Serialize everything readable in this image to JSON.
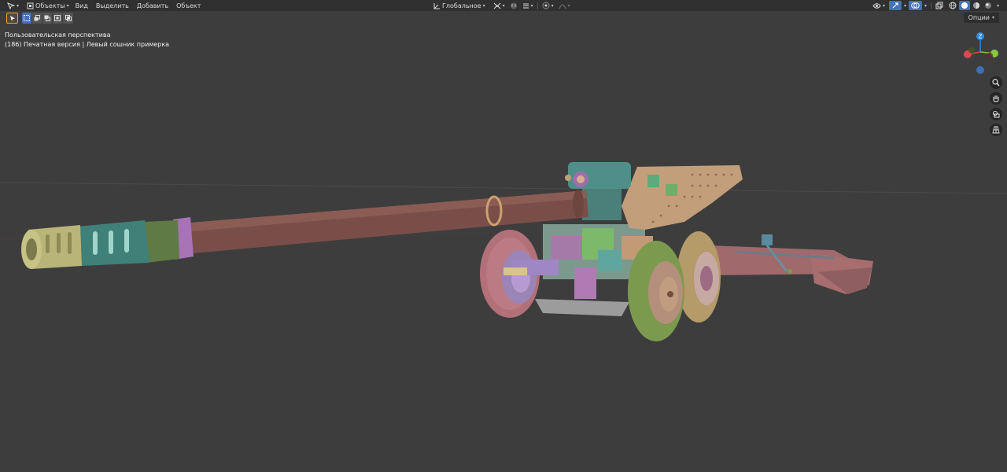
{
  "header": {
    "mode_label": "Объекты",
    "menus": [
      "Вид",
      "Выделить",
      "Добавить",
      "Объект"
    ],
    "orientation_label": "Глобальное"
  },
  "toolbar": {
    "options_label": "Опции"
  },
  "viewport": {
    "view_name": "Пользовательская перспектива",
    "object_info": "(186) Печатная версия | Левый сошник примерка"
  },
  "gizmo": {
    "z_label": "Z",
    "colors": {
      "x": "#e44554",
      "y": "#8bc53f",
      "z": "#2b8ce6",
      "neg": "#3f6fb0"
    }
  },
  "icons": {
    "editor_type": "cursor-tool-icon",
    "mode": "object-mode-icon",
    "transform": "transform-orientation-icon",
    "pivot": "pivot-point-icon",
    "snap": "snap-icon",
    "proportional": "proportional-editing-icon",
    "visibility": "visibility-icon",
    "gizmos": "gizmo-toggle-icon",
    "overlays": "overlays-icon",
    "xray": "xray-icon",
    "shading": [
      "wireframe-shading-icon",
      "solid-shading-icon",
      "material-shading-icon",
      "rendered-shading-icon"
    ],
    "zoom": "zoom-icon",
    "pan": "hand-icon",
    "camera": "camera-icon",
    "ortho": "grid-perspective-icon"
  }
}
